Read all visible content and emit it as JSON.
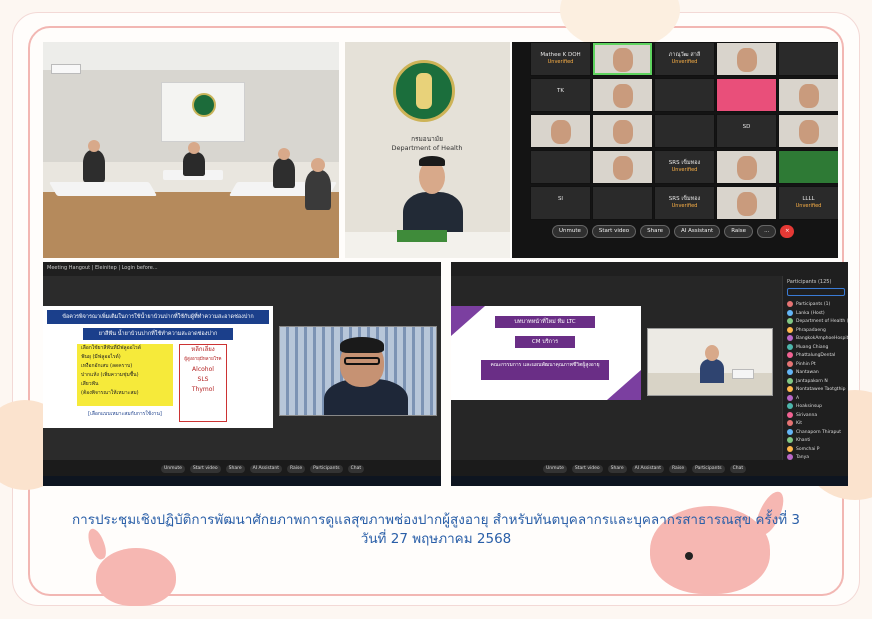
{
  "caption": {
    "line1": "การประชุมเชิงปฏิบัติการพัฒนาศักยภาพการดูแลสุขภาพช่องปากผู้สูงอายุ สำหรับทันตบุคลากรและบุคลากรสาธารณสุข ครั้งที่ 3",
    "line2": "วันที่ 27 พฤษภาคม 2568"
  },
  "photo_official": {
    "org_thai": "กรมอนามัย",
    "org_en": "Department of Health"
  },
  "zoom_grid": {
    "tiles": [
      {
        "name": "Mathee K DOH",
        "status": "Unverified",
        "type": "text"
      },
      {
        "name": "",
        "status": "",
        "type": "video"
      },
      {
        "name": "ภาณุวัฒ สาลี",
        "status": "Unverified",
        "type": "text"
      },
      {
        "name": "",
        "status": "",
        "type": "video"
      },
      {
        "name": "",
        "status": "",
        "type": "dark"
      },
      {
        "name": "TK",
        "status": "",
        "type": "initials"
      },
      {
        "name": "",
        "status": "",
        "type": "video"
      },
      {
        "name": "",
        "status": "",
        "type": "dark"
      },
      {
        "name": "",
        "status": "",
        "type": "pink"
      },
      {
        "name": "",
        "status": "",
        "type": "video"
      },
      {
        "name": "",
        "status": "",
        "type": "video"
      },
      {
        "name": "",
        "status": "",
        "type": "video"
      },
      {
        "name": "",
        "status": "",
        "type": "dark"
      },
      {
        "name": "SD",
        "status": "",
        "type": "initials"
      },
      {
        "name": "",
        "status": "",
        "type": "video"
      },
      {
        "name": "",
        "status": "",
        "type": "dark"
      },
      {
        "name": "",
        "status": "",
        "type": "video"
      },
      {
        "name": "SRS เข็มทอง",
        "status": "Unverified",
        "type": "text"
      },
      {
        "name": "",
        "status": "",
        "type": "video"
      },
      {
        "name": "",
        "status": "",
        "type": "green"
      },
      {
        "name": "SI",
        "status": "",
        "type": "initials"
      },
      {
        "name": "",
        "status": "",
        "type": "dark"
      },
      {
        "name": "SRS เข็มทอง",
        "status": "Unverified",
        "type": "text"
      },
      {
        "name": "",
        "status": "",
        "type": "video"
      },
      {
        "name": "LLLL",
        "status": "Unverified",
        "type": "text"
      }
    ],
    "controls": [
      "Unmute",
      "Start video",
      "Share",
      "AI Assistant",
      "Raise",
      "...",
      "×"
    ]
  },
  "screen_share": {
    "window_title": "Meeting Hangout | Eleinitep | Login before...",
    "slide_title": "ข้อควรพิจารณาเพิ่มเติมในการใช้น้ำยาบ้วนปากที่ใช้กับผู้ที่ทำความสะอาดช่องปาก",
    "slide_sub": "ยาสีฟัน น้ำยาบ้วนปากที่ใช้ทำความสะอาดช่องปาก",
    "yellow_items": [
      "เลือกใช้ยาสีฟันที่มีฟลูออไรด์",
      "ฟันผุ (มีฟลูออไรด์)",
      "เหงือกอักเสบ (ลดคราบ)",
      "ปากแห้ง (เพิ่มความชุ่มชื้น)",
      "เสียวฟัน",
      "(ต้องพิจารณาให้เหมาะสม)"
    ],
    "red_items": [
      "หลีกเลี่ยง",
      "ผู้สูงอายุมีหลายโรค",
      "Alcohol",
      "SLS",
      "Thymol"
    ],
    "slide_footer": "[เลือกแบบเหมาะสมกับการใช้งาน]",
    "controls": [
      "Unmute",
      "Start video",
      "Share",
      "AI Assistant",
      "Raise",
      "Participants",
      "Chat"
    ]
  },
  "presentation2": {
    "ribbons": [
      "บทบาทหน้าที่ใหม่ ทีม LTC",
      "CM บริการ",
      "คณะกรรมการ และแผนพัฒนาคุณภาพชีวิตผู้สูงอายุ"
    ],
    "participants_title": "Participants (125)",
    "participants": [
      "Participants (1)",
      "Lanka (Host)",
      "Department of Health (Thailand)",
      "Phrapadaeng",
      "BangkokAmphoeHospital",
      "Muang Chiang",
      "PhattalungDental",
      "Pinhin Pt",
      "Nantawan",
      "Jantapakorn N",
      "Nontatawee Taotgthip",
      "A",
      "Hoaksinsup",
      "Sirivanna",
      "Kit",
      "Chanaporn Thiraput",
      "Khanti",
      "Somchai P",
      "Tanya"
    ]
  }
}
